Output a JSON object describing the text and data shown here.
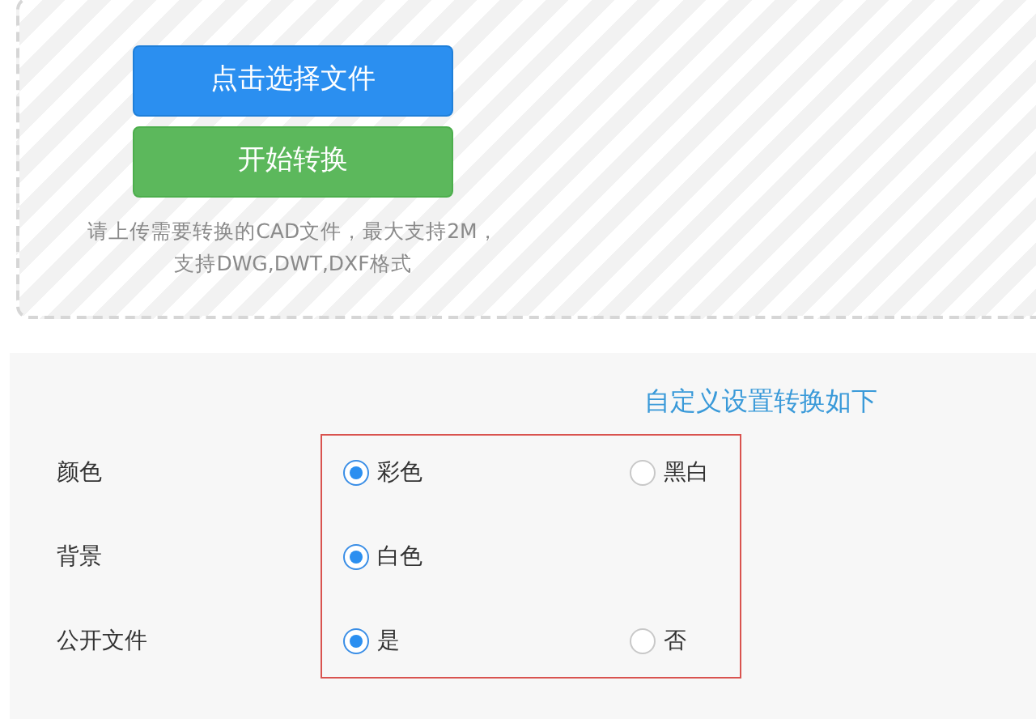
{
  "upload": {
    "select_button": "点击选择文件",
    "convert_button": "开始转换",
    "hint_lines": [
      "请上传需要转换的CAD文件，最大支持2M，",
      "支持DWG,DWT,DXF格式"
    ]
  },
  "settings": {
    "heading": "自定义设置转换如下",
    "highlighted": true,
    "rows": [
      {
        "label": "颜色",
        "options": [
          {
            "label": "彩色",
            "selected": true
          },
          {
            "label": "黑白",
            "selected": false
          }
        ]
      },
      {
        "label": "背景",
        "options": [
          {
            "label": "白色",
            "selected": true
          }
        ]
      },
      {
        "label": "公开文件",
        "options": [
          {
            "label": "是",
            "selected": true
          },
          {
            "label": "否",
            "selected": false
          }
        ]
      }
    ]
  }
}
